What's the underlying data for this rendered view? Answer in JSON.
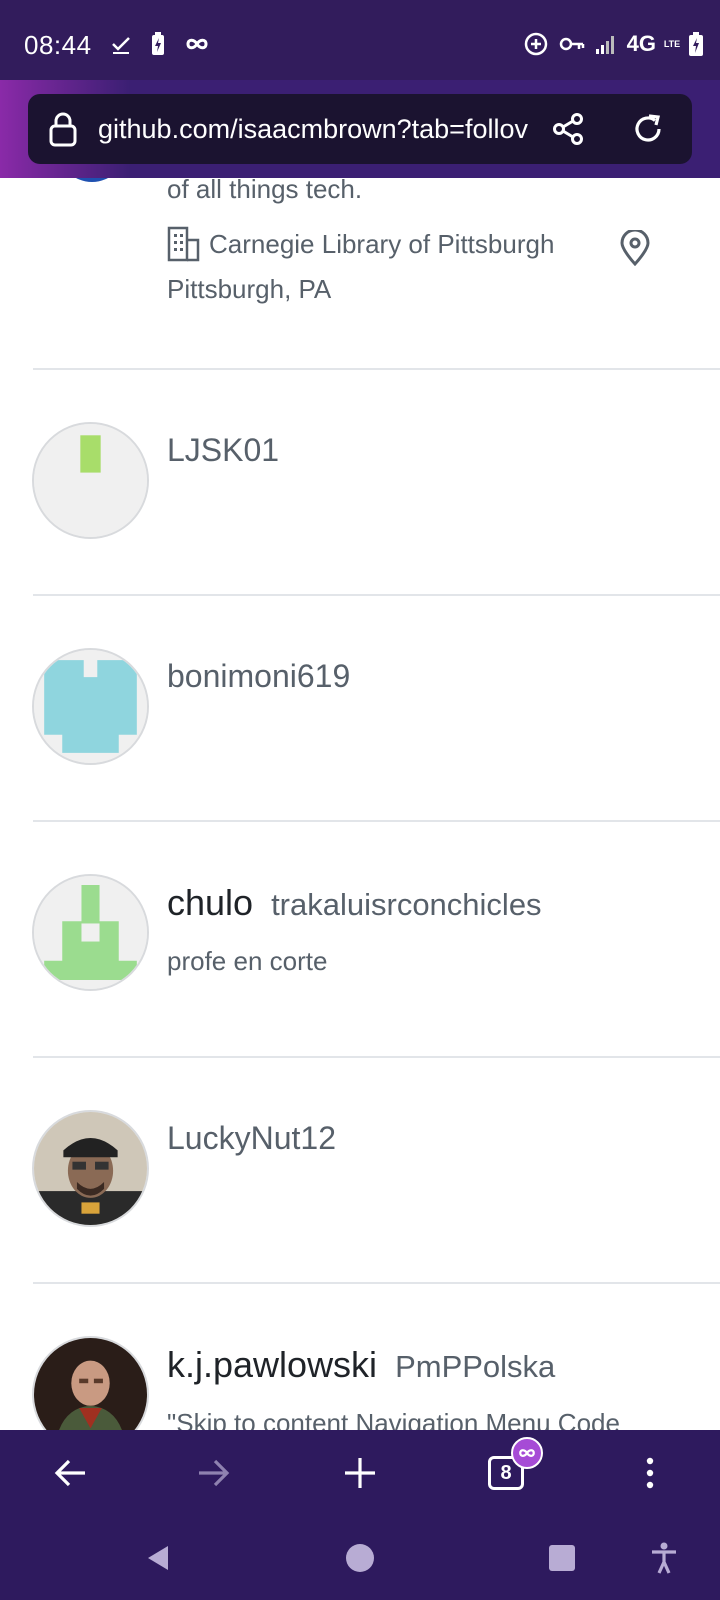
{
  "status_bar": {
    "time": "08:44",
    "network": "4G",
    "network_sub": "LTE",
    "icons_left": [
      "check-icon",
      "battery-saver-icon",
      "infinity-icon"
    ],
    "icons_right": [
      "data-saver-icon",
      "vpn-key-icon",
      "signal-icon",
      "battery-charging-icon"
    ]
  },
  "browser": {
    "url": "github.com/isaacmbrown?tab=follov",
    "tabs_count": "8",
    "accent": "#3b1f73"
  },
  "partial_item": {
    "bio_tail": "of all things tech.",
    "company": "Carnegie Library of Pittsburgh",
    "location": "Pittsburgh, PA"
  },
  "followers": [
    {
      "login": "LJSK01",
      "display_name": "",
      "bio": ""
    },
    {
      "login": "bonimoni619",
      "display_name": "",
      "bio": ""
    },
    {
      "login": "trakaluisrconchicles",
      "display_name": "chulo",
      "bio": "profe en corte"
    },
    {
      "login": "LuckyNut12",
      "display_name": "",
      "bio": ""
    },
    {
      "login": "PmPPolska",
      "display_name": "k.j.pawlowski",
      "bio": "\"Skip to content Navigation Menu Code"
    }
  ]
}
